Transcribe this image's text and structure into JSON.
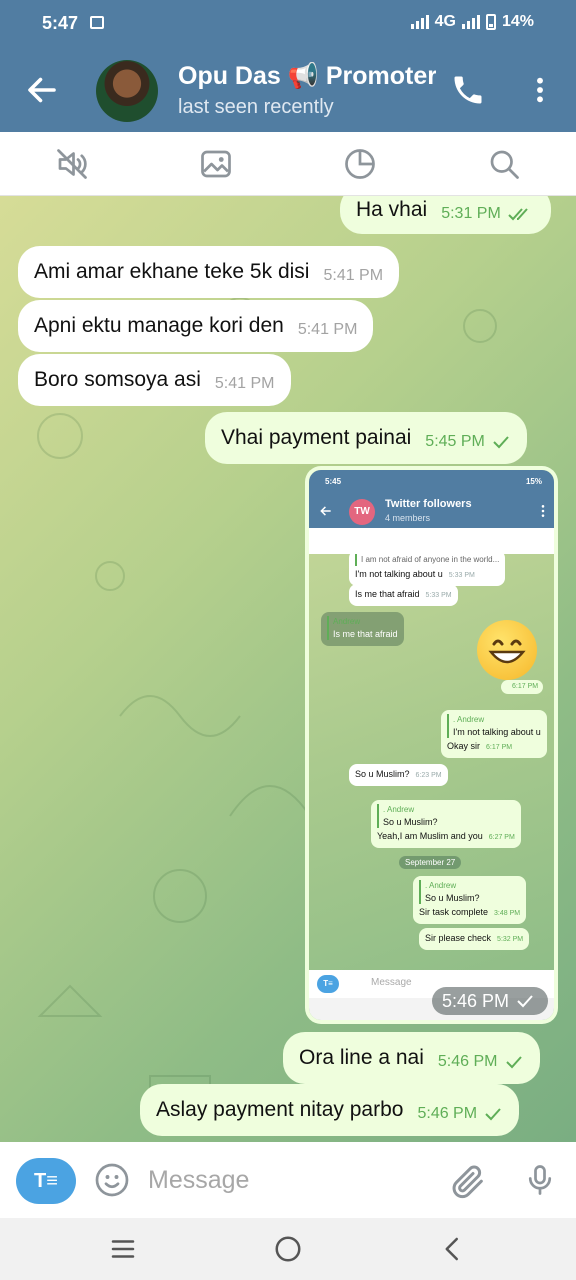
{
  "status_bar": {
    "time": "5:47",
    "network": "4G",
    "battery": "14%"
  },
  "header": {
    "title": "Opu Das 📢 Promoter",
    "subtitle": "last seen recently"
  },
  "messages": [
    {
      "text": "Ha vhai",
      "time": "5:31 PM",
      "direction": "out",
      "status": "read"
    },
    {
      "text": "Ami amar ekhane teke 5k disi",
      "time": "5:41 PM",
      "direction": "in"
    },
    {
      "text": "Apni ektu manage kori den",
      "time": "5:41 PM",
      "direction": "in"
    },
    {
      "text": "Boro somsoya asi",
      "time": "5:41 PM",
      "direction": "in"
    },
    {
      "text": "Vhai payment painai",
      "time": "5:45 PM",
      "direction": "out",
      "status": "sent"
    },
    {
      "text": "Ora line a nai",
      "time": "5:46 PM",
      "direction": "out",
      "status": "sent"
    },
    {
      "text": "Aslay payment nitay parbo",
      "time": "5:46 PM",
      "direction": "out",
      "status": "sent"
    }
  ],
  "photo_message": {
    "time": "5:46 PM",
    "screenshot": {
      "status_time": "5:45",
      "status_battery": "15%",
      "avatar_initials": "TW",
      "group_title": "Twitter followers",
      "group_subtitle": "4 members",
      "messages": [
        {
          "quote": "I am not afraid of anyone in the world...",
          "text": "I'm not talking about u",
          "time": "5:33 PM"
        },
        {
          "text": "Is me that afraid",
          "time": "5:33 PM"
        },
        {
          "quote_name": "Andrew",
          "text": "Is me that afraid"
        },
        {
          "time": "6:17 PM"
        },
        {
          "quote_name": ". Andrew",
          "quote": "I'm not talking about u",
          "text": "Okay sir",
          "time": "6:17 PM"
        },
        {
          "text": "So u Muslim?",
          "time": "6:23 PM"
        },
        {
          "quote_name": ". Andrew",
          "quote": "So u Muslim?",
          "text": "Yeah,I am Muslim and you",
          "time": "6:27 PM"
        },
        {
          "quote_name": ". Andrew",
          "quote": "So u Muslim?",
          "text": "Sir task complete",
          "time": "3:48 PM"
        },
        {
          "text": "Sir please check",
          "time": "5:32 PM"
        }
      ],
      "date_separator": "September 27",
      "input_placeholder": "Message"
    }
  },
  "input": {
    "placeholder": "Message",
    "format_button": "T≡"
  },
  "colors": {
    "header": "#517da2",
    "outgoing_bubble": "#effedd",
    "incoming_bubble": "#ffffff",
    "accent": "#4ba3e2",
    "check": "#5fae57"
  }
}
